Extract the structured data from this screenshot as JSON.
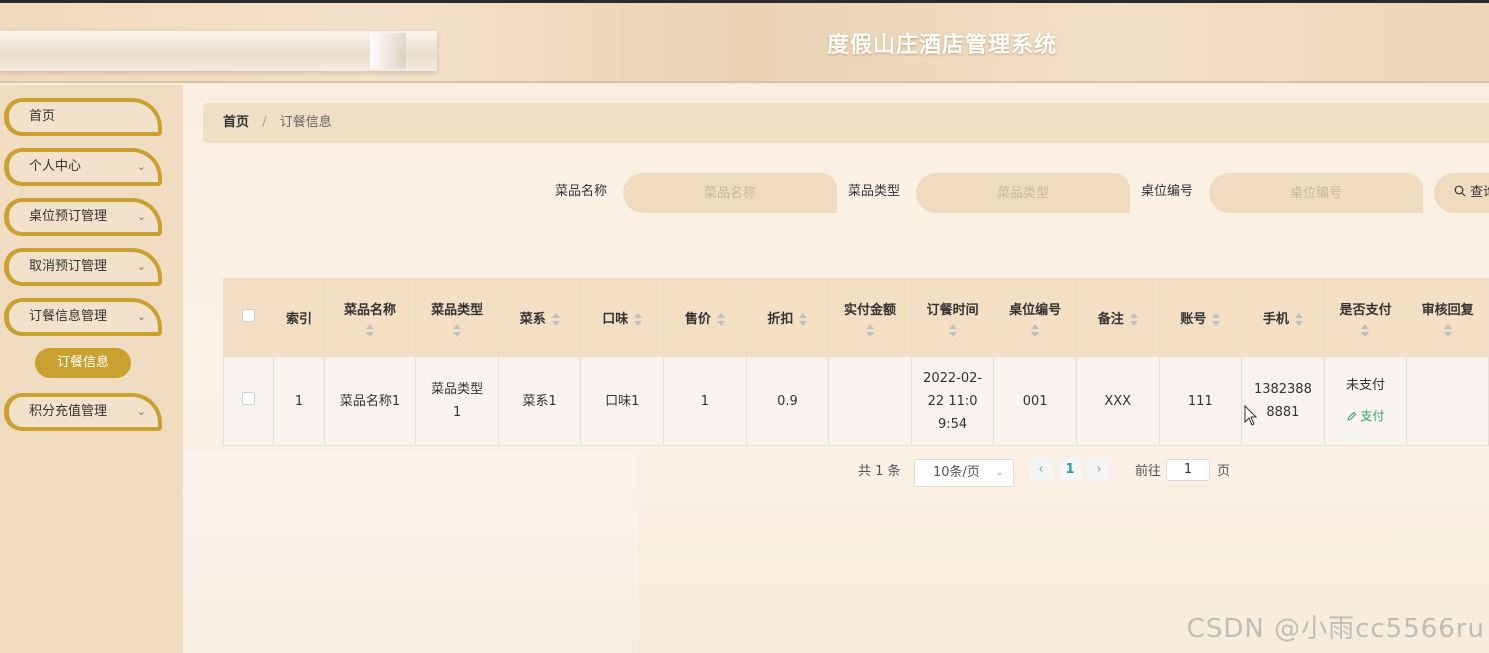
{
  "header": {
    "title": "度假山庄酒店管理系统"
  },
  "sidebar": {
    "items": [
      {
        "label": "首页",
        "has_chevron": false
      },
      {
        "label": "个人中心",
        "has_chevron": true
      },
      {
        "label": "桌位预订管理",
        "has_chevron": true
      },
      {
        "label": "取消预订管理",
        "has_chevron": true
      },
      {
        "label": "订餐信息管理",
        "has_chevron": true
      },
      {
        "label": "积分充值管理",
        "has_chevron": true
      }
    ],
    "active_sub": "订餐信息",
    "chevron_icon": "chevron-down-icon"
  },
  "breadcrumb": {
    "home": "首页",
    "separator": "/",
    "current": "订餐信息"
  },
  "search": {
    "fields": [
      {
        "label": "菜品名称",
        "placeholder": "菜品名称"
      },
      {
        "label": "菜品类型",
        "placeholder": "菜品类型"
      },
      {
        "label": "桌位编号",
        "placeholder": "桌位编号"
      }
    ],
    "button_label": "查询",
    "button_icon": "search-icon"
  },
  "table": {
    "columns": [
      {
        "label": "索引",
        "sortable": false
      },
      {
        "label": "菜品名称",
        "sortable": true
      },
      {
        "label": "菜品类型",
        "sortable": true
      },
      {
        "label": "菜系",
        "sortable": true
      },
      {
        "label": "口味",
        "sortable": true
      },
      {
        "label": "售价",
        "sortable": true
      },
      {
        "label": "折扣",
        "sortable": true
      },
      {
        "label": "实付金额",
        "sortable": true
      },
      {
        "label": "订餐时间",
        "sortable": true
      },
      {
        "label": "桌位编号",
        "sortable": true
      },
      {
        "label": "备注",
        "sortable": true
      },
      {
        "label": "账号",
        "sortable": true
      },
      {
        "label": "手机",
        "sortable": true
      },
      {
        "label": "是否支付",
        "sortable": true
      },
      {
        "label": "审核回复",
        "sortable": true
      }
    ],
    "rows": [
      {
        "index": "1",
        "dish_name": "菜品名称1",
        "dish_type": "菜品类型1",
        "cuisine": "菜系1",
        "flavor": "口味1",
        "price": "1",
        "discount": "0.9",
        "paid_amount": "",
        "order_time": "2022-02-22 11:09:54",
        "table_no": "001",
        "remark": "XXX",
        "account": "111",
        "phone": "13823888881",
        "paid_status": "未支付",
        "pay_action": "支付",
        "pay_icon": "edit-icon",
        "review_reply": ""
      }
    ]
  },
  "pagination": {
    "total_text": "共 1 条",
    "page_size": "10条/页",
    "current_page": "1",
    "goto_label": "前往",
    "goto_value": "1",
    "page_suffix": "页",
    "prev_icon": "chevron-left-icon",
    "next_icon": "chevron-right-icon"
  },
  "watermark": "CSDN @小雨cc5566ru"
}
